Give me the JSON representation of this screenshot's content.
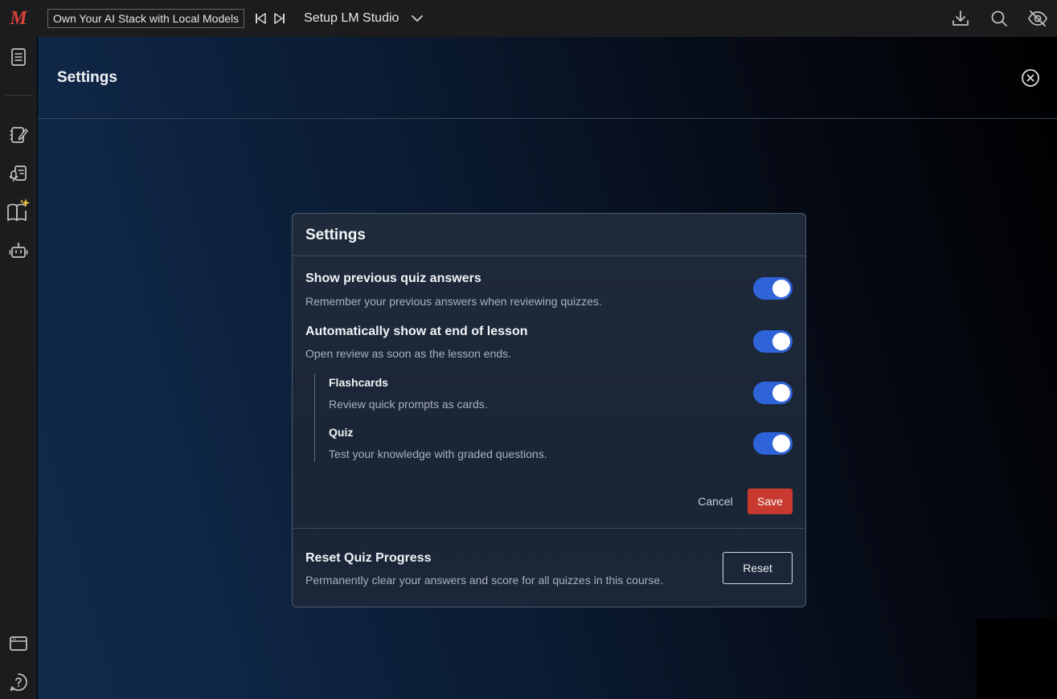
{
  "app": {
    "logo_text": "M",
    "brand_color": "#d9423a"
  },
  "topbar": {
    "course_title": "Own Your AI Stack with Local Models",
    "lesson_title": "Setup LM Studio",
    "icons": [
      "skip-previous-icon",
      "skip-next-icon",
      "chevron-down-icon",
      "download-icon",
      "search-icon",
      "eye-off-icon"
    ]
  },
  "sidebar": {
    "items": [
      "document-icon",
      "notebook-edit-icon",
      "mic-document-icon",
      "ai-book-icon",
      "robot-icon",
      "browser-window-icon",
      "help-circle-icon"
    ]
  },
  "page": {
    "title": "Settings"
  },
  "modal": {
    "title": "Settings",
    "settings": [
      {
        "title": "Show previous quiz answers",
        "description": "Remember your previous answers when reviewing quizzes.",
        "enabled": true
      },
      {
        "title": "Automatically show at end of lesson",
        "description": "Open review as soon as the lesson ends.",
        "enabled": true
      }
    ],
    "sub_settings": [
      {
        "title": "Flashcards",
        "description": "Review quick prompts as cards.",
        "enabled": true
      },
      {
        "title": "Quiz",
        "description": "Test your knowledge with graded questions.",
        "enabled": true
      }
    ],
    "cancel_label": "Cancel",
    "save_label": "Save",
    "reset": {
      "title": "Reset Quiz Progress",
      "description": "Permanently clear your answers and score for all quizzes in this course.",
      "button_label": "Reset"
    }
  },
  "colors": {
    "toggle_on": "#2f63d8",
    "save_button": "#c8392f"
  }
}
